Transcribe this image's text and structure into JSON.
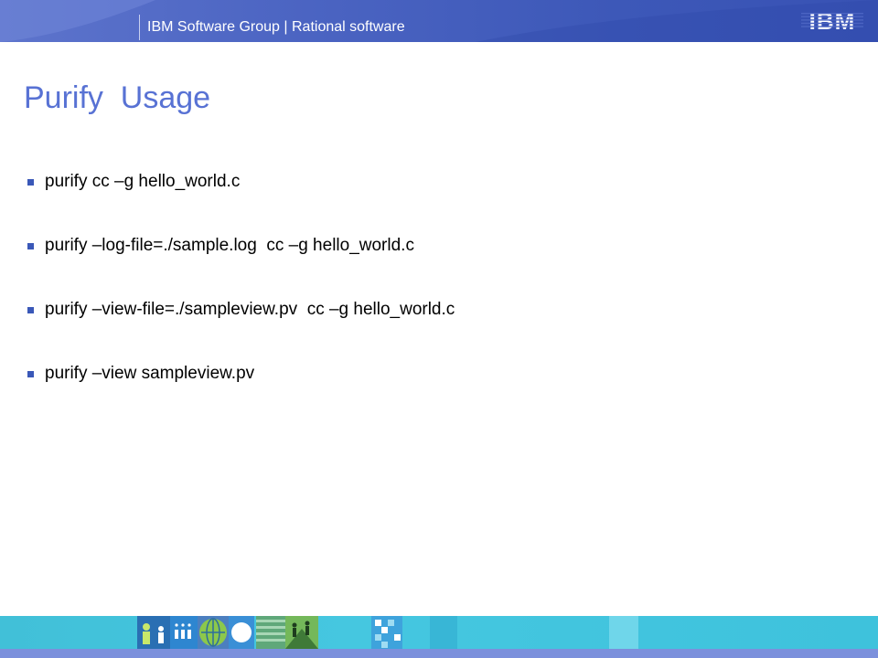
{
  "header": {
    "text": "IBM Software Group | Rational software",
    "logo_text": "IBM"
  },
  "slide": {
    "title": "Purify  Usage",
    "bullets": [
      "purify cc –g hello_world.c",
      "purify –log-file=./sample.log  cc –g hello_world.c",
      "purify –view-file=./sampleview.pv  cc –g hello_world.c",
      "purify –view sampleview.pv"
    ]
  },
  "colors": {
    "header_bg": "#4b64c2",
    "title": "#5872d4",
    "bullet_marker": "#3a58b8",
    "footer_bg": "#45c7e0",
    "footer_line": "#7b90dc"
  },
  "footer": {
    "images": [
      "people-icon",
      "photo-tile",
      "globe-icon",
      "circle-icon",
      "stripes-tile",
      "hikers-photo",
      "pixel-tile"
    ]
  }
}
